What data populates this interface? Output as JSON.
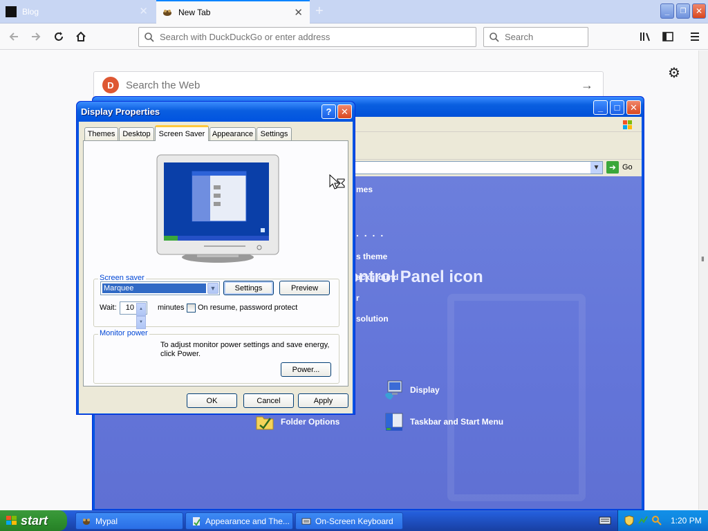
{
  "browser": {
    "tabs": [
      {
        "label": "Blog"
      },
      {
        "label": "New Tab"
      }
    ],
    "close_glyph": "✕",
    "new_tab_glyph": "+",
    "url_placeholder": "Search with DuckDuckGo or enter address",
    "search_placeholder": "Search",
    "page_search_placeholder": "Search the Web"
  },
  "control_panel": {
    "go_label": "Go",
    "links": [
      "mes",
      "s theme",
      "ackground",
      "r",
      "solution"
    ],
    "heading": "ontrol Panel icon",
    "icons": [
      {
        "label": "Display",
        "icon": "display-icon"
      },
      {
        "label": "Folder Options",
        "icon": "folder-options-icon"
      },
      {
        "label": "Taskbar and Start Menu",
        "icon": "taskbar-start-menu-icon"
      }
    ]
  },
  "dialog": {
    "title": "Display Properties",
    "help_glyph": "?",
    "close_glyph": "✕",
    "tabs": [
      "Themes",
      "Desktop",
      "Screen Saver",
      "Appearance",
      "Settings"
    ],
    "selected_tab": "Screen Saver",
    "screen_saver": {
      "group_label": "Screen saver",
      "selected": "Marquee",
      "settings_label": "Settings",
      "preview_label": "Preview",
      "wait_label": "Wait:",
      "wait_value": "10",
      "minutes_label": "minutes",
      "password_label": "On resume, password protect",
      "password_checked": false
    },
    "monitor_power": {
      "group_label": "Monitor power",
      "description": "To adjust monitor power settings and save energy, click Power.",
      "power_label": "Power..."
    },
    "ok_label": "OK",
    "cancel_label": "Cancel",
    "apply_label": "Apply"
  },
  "taskbar": {
    "start_label": "start",
    "items": [
      {
        "label": "Mypal"
      },
      {
        "label": "Appearance and The..."
      },
      {
        "label": "On-Screen Keyboard"
      }
    ],
    "clock": "1:20 PM"
  }
}
